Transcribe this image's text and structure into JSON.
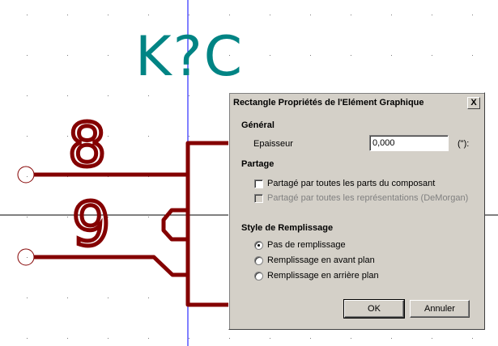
{
  "schematic": {
    "reference": "K?C",
    "pin_numbers": [
      "8",
      "9"
    ],
    "colors": {
      "reference_text": "#008484",
      "body": "#840000",
      "crosshair": "#0000ff",
      "background": "#ffffff",
      "grid_dot": "#7a7a7a"
    }
  },
  "dialog": {
    "title": "Rectangle Propriétés de l'Elément Graphique",
    "close_symbol": "X",
    "general": {
      "heading": "Général",
      "thickness_label": "Epaisseur",
      "thickness_value": "0,000",
      "unit": "(\"):"
    },
    "sharing": {
      "heading": "Partage",
      "option_parts": "Partagé par toutes les parts du composant",
      "option_parts_checked": false,
      "option_representations": "Partagé par toutes les représentations  (DeMorgan)",
      "option_representations_enabled": false
    },
    "fill": {
      "heading": "Style de Remplissage",
      "options": [
        "Pas de remplissage",
        "Remplissage en avant plan",
        "Remplissage en arrière plan"
      ],
      "selected_index": 0
    },
    "buttons": {
      "ok": "OK",
      "cancel": "Annuler"
    }
  }
}
